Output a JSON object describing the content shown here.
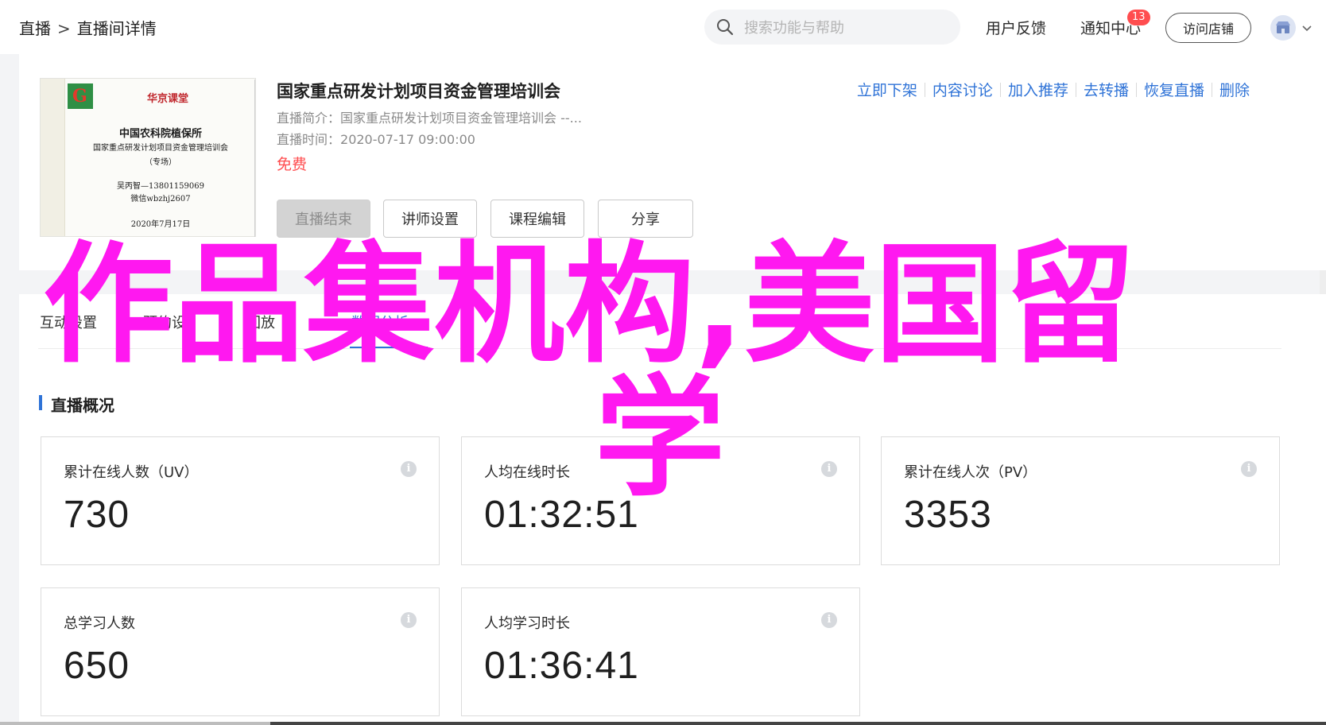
{
  "breadcrumb": {
    "root": "直播",
    "separator": ">",
    "current": "直播间详情"
  },
  "search": {
    "placeholder": "搜索功能与帮助"
  },
  "header": {
    "feedback": "用户反馈",
    "notifications": "通知中心",
    "notification_count": "13",
    "visit_store": "访问店铺"
  },
  "course": {
    "title": "国家重点研发计划项目资金管理培训会",
    "intro_label": "直播简介：",
    "intro_value": "国家重点研发计划项目资金管理培训会 --...",
    "time_label": "直播时间：",
    "time_value": "2020-07-17 09:00:00",
    "price": "免费",
    "cover": {
      "brand": "华京课堂",
      "org": "中国农科院植保所",
      "subject": "国家重点研发计划项目资金管理培训会",
      "note": "（专场）",
      "contact1": "吴丙智—13801159069",
      "contact2": "微信wbzhj2607",
      "date": "2020年7月17日"
    },
    "actions": [
      "立即下架",
      "内容讨论",
      "加入推荐",
      "去转播",
      "恢复直播",
      "删除"
    ],
    "buttons": {
      "end_live": "直播结束",
      "teacher_settings": "讲师设置",
      "course_edit": "课程编辑",
      "share": "分享"
    }
  },
  "tabs": [
    "互动设置",
    "预约设",
    "回放",
    "数据分析"
  ],
  "overview": {
    "title": "直播概况",
    "stats": [
      {
        "label": "累计在线人数（UV）",
        "value": "730"
      },
      {
        "label": "人均在线时长",
        "value": "01:32:51"
      },
      {
        "label": "累计在线人次（PV）",
        "value": "3353"
      },
      {
        "label": "总学习人数",
        "value": "650"
      },
      {
        "label": "人均学习时长",
        "value": "01:36:41"
      }
    ]
  },
  "overlay": {
    "line1": "作品集机构,美国留",
    "line2": "学"
  },
  "colors": {
    "accent": "#2f73d7",
    "price": "#ff4d4f",
    "overlay": "#ff18f0",
    "badge": "#ff4d4f"
  }
}
